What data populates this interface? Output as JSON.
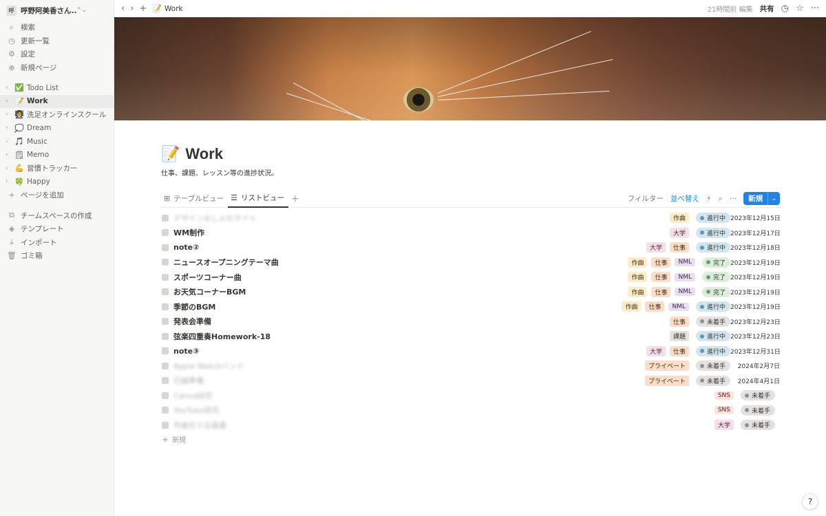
{
  "colors": {
    "accent": "#2383e2",
    "sidebar_bg": "#f7f7f5",
    "text": "#37352f"
  },
  "workspace": {
    "badge": "呼",
    "name": "呼野阿美香さん...",
    "chevron": "⌃⌄"
  },
  "sidebar": {
    "menu": [
      {
        "icon": "search-icon",
        "glyph": "⌕",
        "label": "検索"
      },
      {
        "icon": "clock-icon",
        "glyph": "◷",
        "label": "更新一覧"
      },
      {
        "icon": "gear-icon",
        "glyph": "⚙",
        "label": "設定"
      },
      {
        "icon": "plus-circle-icon",
        "glyph": "⊕",
        "label": "新規ページ"
      }
    ],
    "pages": [
      {
        "emoji": "✅",
        "label": "Todo List",
        "active": false
      },
      {
        "emoji": "📝",
        "label": "Work",
        "active": true
      },
      {
        "emoji": "👩‍🏫",
        "label": "洗足オンラインスクール",
        "active": false
      },
      {
        "emoji": "💭",
        "label": "Dream",
        "active": false
      },
      {
        "emoji": "🎵",
        "label": "Music",
        "active": false
      },
      {
        "emoji": "🗒",
        "label": "Memo",
        "active": false
      },
      {
        "emoji": "💪",
        "label": "習慣トラッカー",
        "active": false
      },
      {
        "emoji": "🍀",
        "label": "Happy",
        "active": false
      }
    ],
    "add_page": "ページを追加",
    "bottom": [
      {
        "icon": "team-icon",
        "glyph": "⧉",
        "label": "チームスペースの作成"
      },
      {
        "icon": "template-icon",
        "glyph": "◈",
        "label": "テンプレート"
      },
      {
        "icon": "import-icon",
        "glyph": "⤓",
        "label": "インポート"
      },
      {
        "icon": "trash-icon",
        "glyph": "🗑",
        "label": "ゴミ箱"
      }
    ]
  },
  "topbar": {
    "back": "‹",
    "forward": "›",
    "add": "+",
    "crumb_emoji": "📝",
    "crumb": "Work",
    "edited": "21時間前 編集",
    "share": "共有",
    "history_glyph": "◷",
    "star_glyph": "☆",
    "more_glyph": "···"
  },
  "page": {
    "emoji": "📝",
    "title": "Work",
    "description": "仕事、課題、レッスン等の進捗状況。"
  },
  "views": {
    "tabs": [
      {
        "glyph": "⊞",
        "label": "テーブルビュー",
        "active": false
      },
      {
        "glyph": "☰",
        "label": "リストビュー",
        "active": true
      }
    ],
    "add_glyph": "+",
    "filter": "フィルター",
    "sort": "並べ替え",
    "bolt_glyph": "⚡",
    "search_glyph": "⌕",
    "more_glyph": "···",
    "new_label": "新規",
    "new_chevron": "⌄"
  },
  "tag_styles": {
    "作曲": {
      "bg": "#fdecc8",
      "fg": "#402c1b"
    },
    "大学": {
      "bg": "#f5e0e9",
      "fg": "#4c2337"
    },
    "仕事": {
      "bg": "#fadec9",
      "fg": "#49290e"
    },
    "NML": {
      "bg": "#e8deee",
      "fg": "#412454"
    },
    "課題": {
      "bg": "#e3e2e0",
      "fg": "#32302c"
    },
    "プライベート": {
      "bg": "#fadec9",
      "fg": "#49290e"
    },
    "SNS": {
      "bg": "#ffe2dd",
      "fg": "#5d1715"
    }
  },
  "status_styles": {
    "進行中": {
      "bg": "#d3e5ef",
      "dot": "#5b97bd"
    },
    "完了": {
      "bg": "#dbeddb",
      "dot": "#6c9b7d"
    },
    "未着手": {
      "bg": "#e3e2e0",
      "dot": "#91918e"
    }
  },
  "rows": [
    {
      "name": "デザインおしゃれサイト",
      "blurred": true,
      "tags": [
        "作曲"
      ],
      "status": "進行中",
      "date": "2023年12月15日"
    },
    {
      "name": "WM制作",
      "blurred": false,
      "tags": [
        "大学"
      ],
      "status": "進行中",
      "date": "2023年12月17日"
    },
    {
      "name": "note②",
      "blurred": false,
      "tags": [
        "大学",
        "仕事"
      ],
      "status": "進行中",
      "date": "2023年12月18日"
    },
    {
      "name": "ニュースオープニングテーマ曲",
      "blurred": false,
      "tags": [
        "作曲",
        "仕事",
        "NML"
      ],
      "status": "完了",
      "date": "2023年12月19日"
    },
    {
      "name": "スポーツコーナー曲",
      "blurred": false,
      "tags": [
        "作曲",
        "仕事",
        "NML"
      ],
      "status": "完了",
      "date": "2023年12月19日"
    },
    {
      "name": "お天気コーナーBGM",
      "blurred": false,
      "tags": [
        "作曲",
        "仕事",
        "NML"
      ],
      "status": "完了",
      "date": "2023年12月19日"
    },
    {
      "name": "季節のBGM",
      "blurred": false,
      "tags": [
        "作曲",
        "仕事",
        "NML"
      ],
      "status": "進行中",
      "date": "2023年12月19日"
    },
    {
      "name": "発表会準備",
      "blurred": false,
      "tags": [
        "仕事"
      ],
      "status": "未着手",
      "date": "2023年12月23日"
    },
    {
      "name": "弦楽四重奏Homework-18",
      "blurred": false,
      "tags": [
        "課題"
      ],
      "status": "進行中",
      "date": "2023年12月23日"
    },
    {
      "name": "note③",
      "blurred": false,
      "tags": [
        "大学",
        "仕事"
      ],
      "status": "進行中",
      "date": "2023年12月31日"
    },
    {
      "name": "Apple Watchバンド",
      "blurred": true,
      "tags": [
        "プライベート"
      ],
      "status": "未着手",
      "date": "2024年2月7日"
    },
    {
      "name": "引越準備",
      "blurred": true,
      "tags": [
        "プライベート"
      ],
      "status": "未着手",
      "date": "2024年4月1日"
    },
    {
      "name": "Canva研究",
      "blurred": true,
      "tags": [
        "SNS"
      ],
      "status": "未着手",
      "date": ""
    },
    {
      "name": "YouTube研究",
      "blurred": true,
      "tags": [
        "SNS"
      ],
      "status": "未着手",
      "date": ""
    },
    {
      "name": "作曲ゼミ企画書",
      "blurred": true,
      "tags": [
        "大学"
      ],
      "status": "未着手",
      "date": ""
    }
  ],
  "add_row": {
    "glyph": "+",
    "label": "新規"
  },
  "help": "?"
}
